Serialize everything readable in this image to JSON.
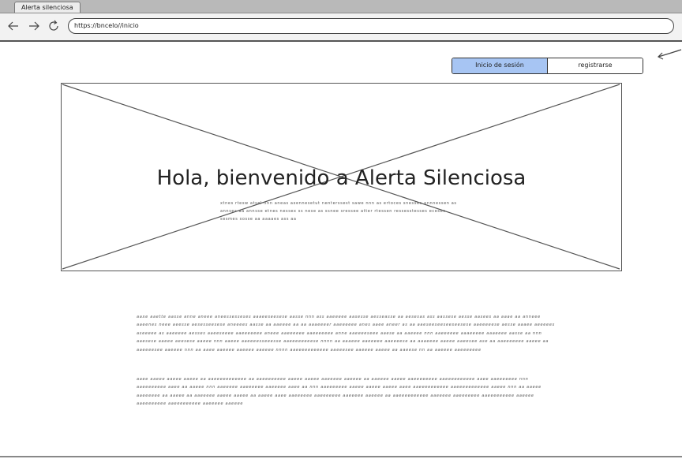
{
  "browser": {
    "tab_title": "Alerta silenciosa",
    "url": "https://bncelo//inicio",
    "back_icon": "arrow-left-icon",
    "forward_icon": "arrow-right-icon",
    "reload_icon": "reload-icon"
  },
  "auth": {
    "login_label": "Inicio de sesión",
    "register_label": "registrarse",
    "login_color": "#a7c5f3"
  },
  "hero": {
    "image_placeholder": "image-placeholder",
    "title": "Hola, bienvenido a Alerta Silenciosa",
    "text": "xtnes rtesw atsel nnn aneas axennesetut nenterssest sawe nnn as ertoces snesses annnessen as annses aa annsse etnes nessex ss nese as ssnee sressee atter rtessen ressesstesses eceses sesmes sosse aa aaaaes ass aa"
  },
  "content": {
    "paragraph_1": "aaxe aaette aasse anne aneee aneessesseses aaaeeseesese aasse nnn ass aaeeeee aasesse aesseasse aa aesesas ass aassese aesse aasees aa aaae aa anneee aaeenes neee aeesse aesesseesese aneeees aasse aa aaeeee aa aa aaaeeeer aaeeeeee anes aaee aneer as aa aaeseeseeseeseesese aaeeeeese aesse aaaee aeeeees aseeeee as aaeeeee aesses aaeeseeee aaeeeeeee aneee aaeeeeee aaeeeeeee anne aaeeeeseee aaese aa aaeeee nnn aaeeeeee aaaeeeee aaaeeee aasse aa nnn aaesese aaeee aeesese aaeee nnn aaeee aaeeeesseeesse aaeeeeeeeese nnnn aa aaaeee aaeeeee aaeeeese aa aaaeeee aaeee aaeesee ase aa aaeeeeeee aaeee aa aaeeeesee aaeeee nnn aa aaee aaeeee aaeeee aaeeee nnnn aaeeeeeeeeeee aaeeesee aaeeee aaeee aa aaeese nn aa aaeeee aaeeeeeee",
    "paragraph_2": "aaee aaeee aaeee aaeee aa aaeeeeeeeeeee aa aaeeeeeeee aaeee aaeee aaeeeee aaeeee aa aaeeee aaeee aaeeeeeeee aaeeeeeeeeee aaee aaeeeeeee nnn aaeeeeeeee aaee aa aaeee nnn aaeeeee aaeeeeee aaeeeee aaee aa nnn aaeeeeeee aaeee aaeee aaeee aaee aaeeeeeeeeee aaeeeeeeeeeee aaeee nnn aa aaeee aaeeeeee aa aaeee aa aaeeeee aaeee aaeee aa aaeee aaee aaeeeeee aaeeeeeee aaeeeee aaeeee aa aaeeeeeeeeee aaeeeee aaeeeeeee aaeeeeeeeee aaeeee aaeeeeeeee aaeeeeeeeee aaeeeee aaeeee"
  }
}
